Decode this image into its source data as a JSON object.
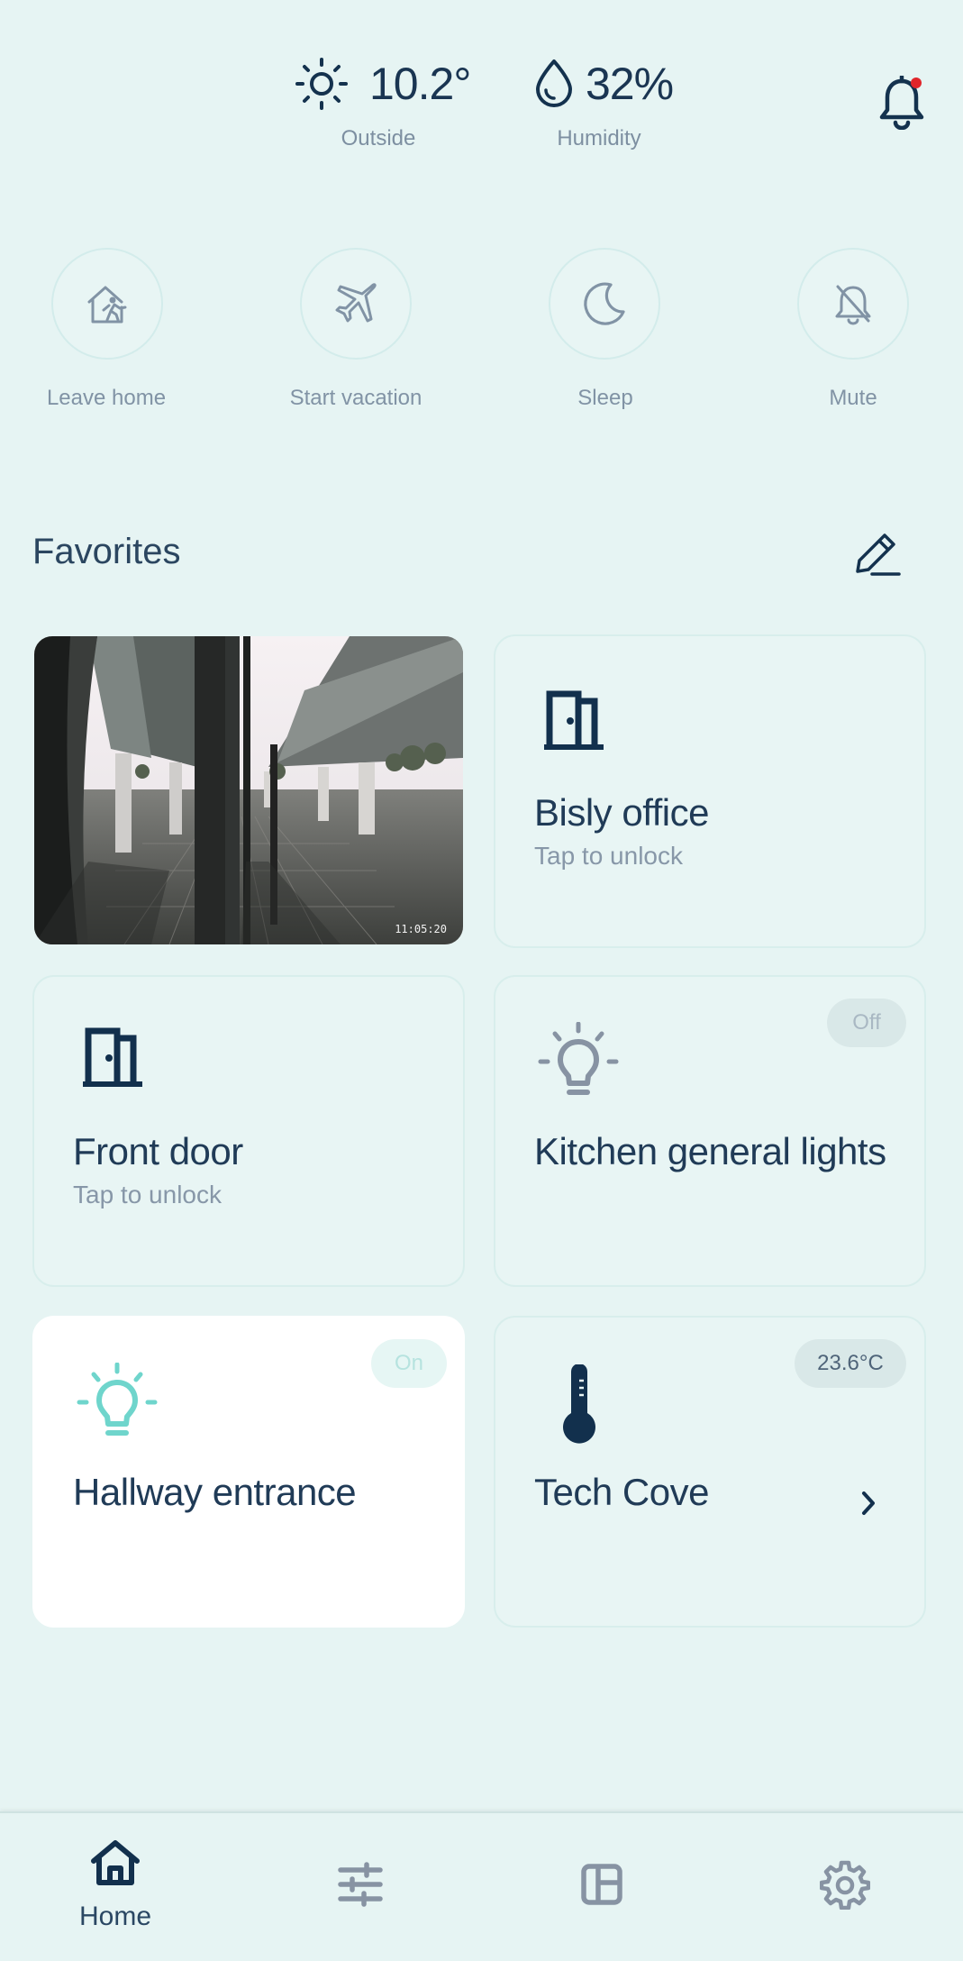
{
  "weather": {
    "outside_value": "10.2°",
    "outside_label": "Outside",
    "humidity_value": "32%",
    "humidity_label": "Humidity"
  },
  "notifications": {
    "has_unread": true,
    "dot_color": "#e0262b"
  },
  "scenes": [
    {
      "label": "Leave home",
      "icon": "leave-home-icon"
    },
    {
      "label": "Start vacation",
      "icon": "airplane-icon"
    },
    {
      "label": "Sleep",
      "icon": "moon-icon"
    },
    {
      "label": "Mute",
      "icon": "bell-off-icon"
    }
  ],
  "favorites": {
    "title": "Favorites",
    "camera": {
      "timestamp": "11:05:20"
    },
    "cards": [
      {
        "title": "Bisly office",
        "subtitle": "Tap to unlock",
        "icon": "door-icon"
      },
      {
        "title": "Front door",
        "subtitle": "Tap to unlock",
        "icon": "door-icon"
      },
      {
        "title": "Kitchen general lights",
        "status": "Off",
        "icon": "lightbulb-icon"
      },
      {
        "title": "Hallway entrance",
        "status": "On",
        "icon": "lightbulb-icon"
      },
      {
        "title": "Tech Cove",
        "status": "23.6°C",
        "icon": "thermometer-icon"
      }
    ]
  },
  "nav": {
    "home_label": "Home",
    "items": [
      "home-icon",
      "sliders-icon",
      "layout-icon",
      "gear-icon"
    ]
  },
  "colors": {
    "background": "#e6f4f3",
    "navy": "#12304d",
    "accent_teal": "#6fd5cc",
    "muted": "#8193a5"
  }
}
